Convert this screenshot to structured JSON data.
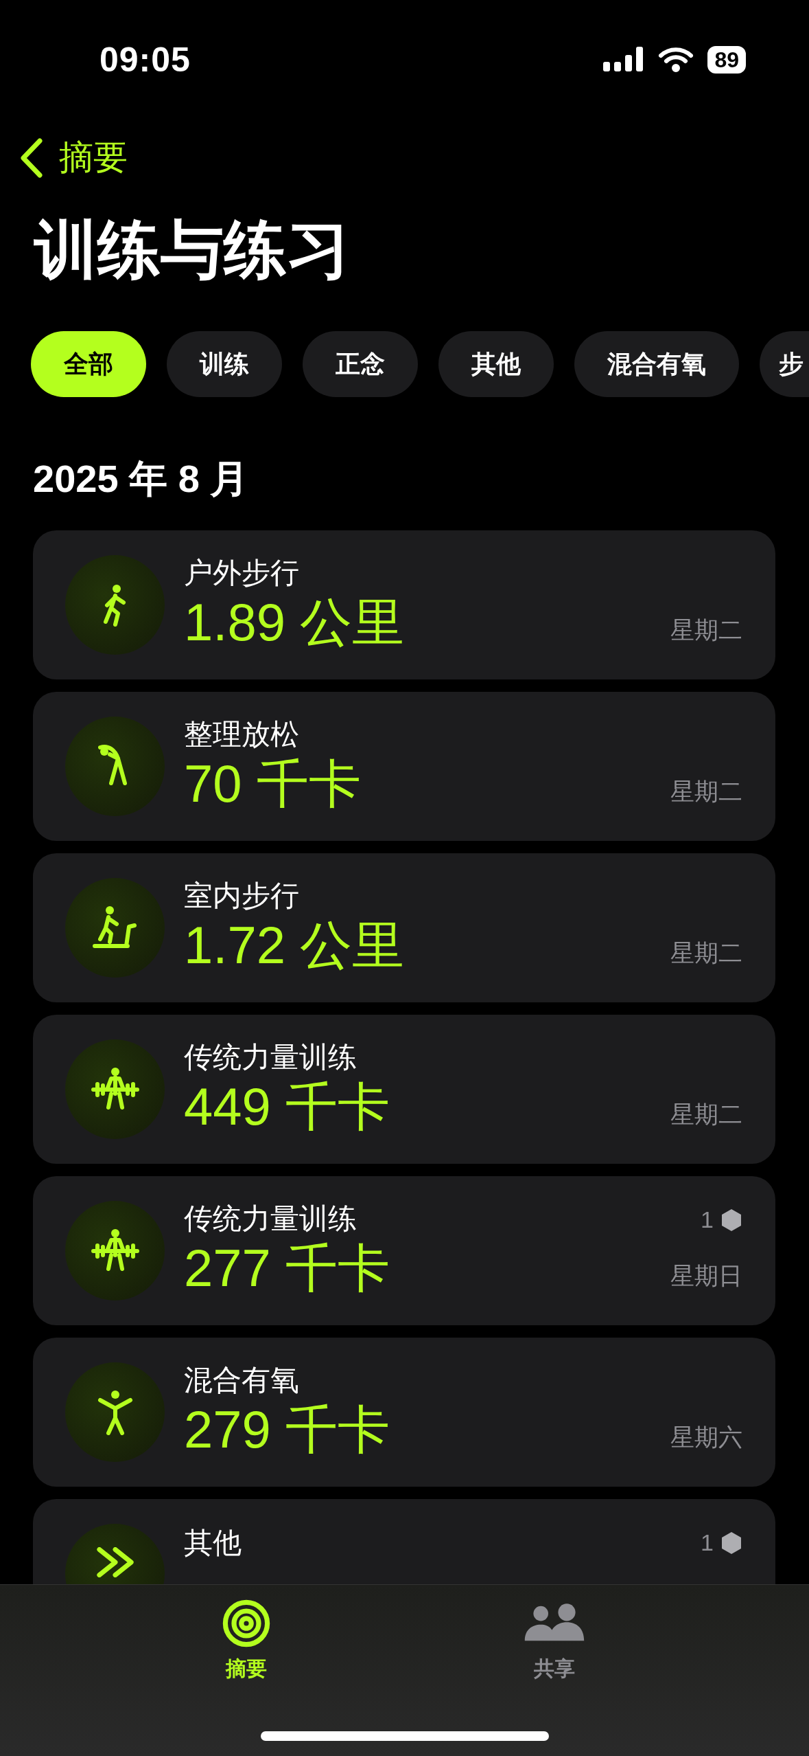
{
  "status_bar": {
    "time": "09:05",
    "battery": "89"
  },
  "nav": {
    "back_label": "摘要"
  },
  "title": "训练与练习",
  "filters": [
    {
      "label": "全部",
      "selected": true
    },
    {
      "label": "训练",
      "selected": false
    },
    {
      "label": "正念",
      "selected": false
    },
    {
      "label": "其他",
      "selected": false
    },
    {
      "label": "混合有氧",
      "selected": false
    },
    {
      "label": "步",
      "selected": false
    }
  ],
  "section_title": "2025 年 8 月",
  "workouts": [
    {
      "kind": "walk",
      "name": "户外步行",
      "value": "1.89 公里",
      "day": "星期二"
    },
    {
      "kind": "stretch",
      "name": "整理放松",
      "value": "70 千卡",
      "day": "星期二"
    },
    {
      "kind": "treadmill",
      "name": "室内步行",
      "value": "1.72 公里",
      "day": "星期二"
    },
    {
      "kind": "strength",
      "name": "传统力量训练",
      "value": "449 千卡",
      "day": "星期二"
    },
    {
      "kind": "strength",
      "name": "传统力量训练",
      "value": "277 千卡",
      "day": "星期日",
      "badge": "1"
    },
    {
      "kind": "jump",
      "name": "混合有氧",
      "value": "279 千卡",
      "day": "星期六"
    },
    {
      "kind": "other",
      "name": "其他",
      "badge": "1"
    }
  ],
  "tab_bar": [
    {
      "kind": "summary",
      "label": "摘要",
      "selected": true
    },
    {
      "kind": "sharing",
      "label": "共享",
      "selected": false
    }
  ]
}
